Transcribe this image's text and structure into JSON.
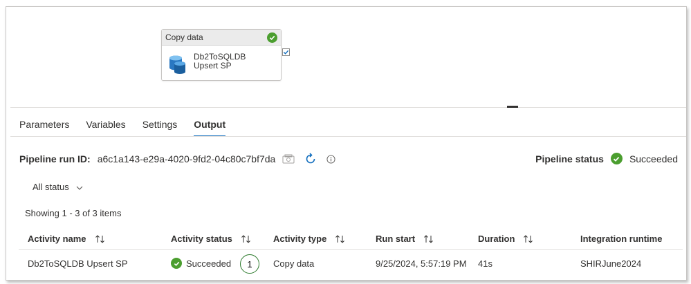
{
  "canvas": {
    "activity": {
      "type_label": "Copy data",
      "name": "Db2ToSQLDB Upsert SP",
      "status_color": "#4b9e2f"
    }
  },
  "tabs": [
    {
      "label": "Parameters",
      "active": false
    },
    {
      "label": "Variables",
      "active": false
    },
    {
      "label": "Settings",
      "active": false
    },
    {
      "label": "Output",
      "active": true
    }
  ],
  "run": {
    "label": "Pipeline run ID:",
    "id": "a6c1a143-e29a-4020-9fd2-04c80c7bf7da"
  },
  "pipeline_status": {
    "label": "Pipeline status",
    "value": "Succeeded"
  },
  "filter": {
    "label": "All status"
  },
  "showing": "Showing 1 - 3 of 3 items",
  "table": {
    "columns": [
      "Activity name",
      "Activity status",
      "Activity type",
      "Run start",
      "Duration",
      "Integration runtime"
    ],
    "rows": [
      {
        "activity_name": "Db2ToSQLDB Upsert SP",
        "activity_status": "Succeeded",
        "activity_type": "Copy data",
        "run_start": "9/25/2024, 5:57:19 PM",
        "duration": "41s",
        "integration_runtime": "SHIRJune2024"
      }
    ]
  },
  "callout": "1",
  "icons": [
    "check-icon",
    "database-icon",
    "copy-icon",
    "refresh-icon",
    "info-icon",
    "chevron-down-icon",
    "sort-icon"
  ]
}
